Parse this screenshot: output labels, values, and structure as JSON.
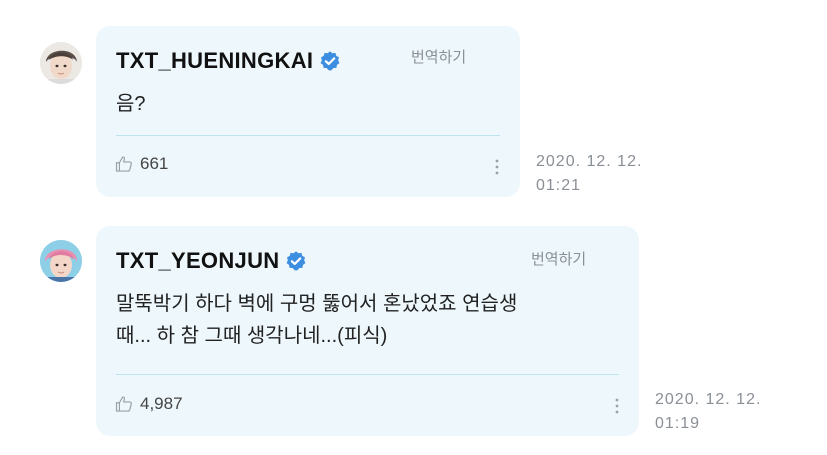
{
  "comments": [
    {
      "author": "TXT_HUENINGKAI",
      "translate_label": "번역하기",
      "text": "음?",
      "likes": "661",
      "date": "2020. 12. 12.",
      "time": "01:21",
      "avatar_icon": "user-avatar-hueningkai"
    },
    {
      "author": "TXT_YEONJUN",
      "translate_label": "번역하기",
      "text_line1": "말뚝박기 하다 벽에 구멍 뚫어서 혼났었죠 연습생",
      "text_line2": "때... 하 참 그때 생각나네...(피식)",
      "likes": "4,987",
      "date": "2020. 12. 12.",
      "time": "01:19",
      "avatar_icon": "user-avatar-yeonjun"
    }
  ],
  "colors": {
    "bubble_bg": "#eef8fc",
    "verified_blue": "#3d8ee0",
    "divider": "#bfe4ef",
    "muted_text": "#8a8f96"
  },
  "icons": [
    "verified-badge-icon",
    "thumbs-up-icon",
    "more-options-icon"
  ]
}
